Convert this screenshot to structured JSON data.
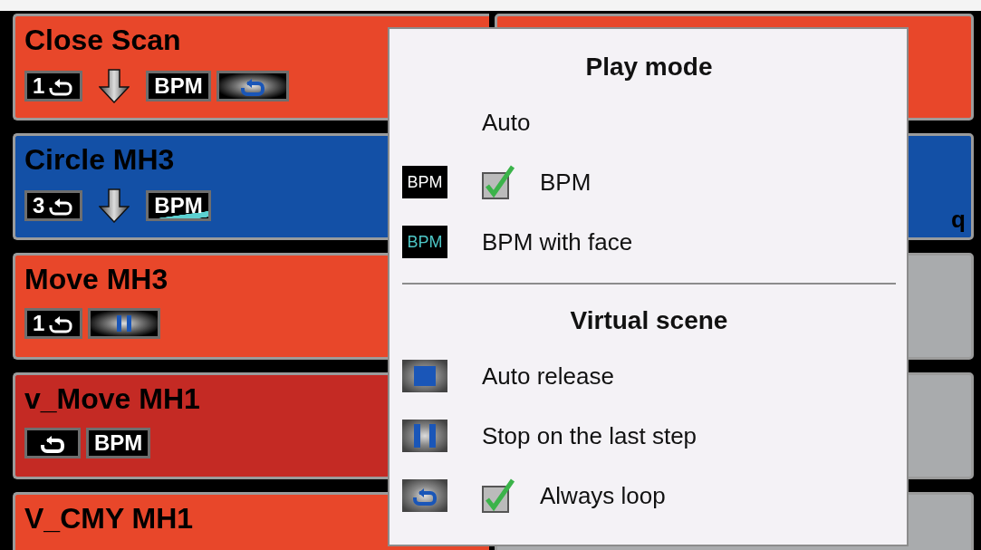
{
  "left_tiles": [
    {
      "name": "Close Scan",
      "color": "#e8472a",
      "badges": [
        {
          "kind": "count-loop",
          "text": "1"
        },
        {
          "kind": "arrow-down"
        },
        {
          "kind": "bpm",
          "text": "BPM"
        },
        {
          "kind": "loop-glow"
        }
      ]
    },
    {
      "name": "Circle MH3",
      "color": "#1350a6",
      "badges": [
        {
          "kind": "count-loop",
          "text": "3"
        },
        {
          "kind": "arrow-down"
        },
        {
          "kind": "bpm-fade",
          "text": "BPM"
        }
      ]
    },
    {
      "name": "Move MH3",
      "color": "#e8472a",
      "badges": [
        {
          "kind": "count-loop",
          "text": "1"
        },
        {
          "kind": "pause-glow"
        }
      ]
    },
    {
      "name": "v_Move MH1",
      "color": "#c42a24",
      "badges": [
        {
          "kind": "loop"
        },
        {
          "kind": "bpm",
          "text": "BPM"
        }
      ]
    },
    {
      "name": "V_CMY MH1",
      "color": "#e8472a"
    }
  ],
  "right_tiles": [
    {
      "color": "#e8472a"
    },
    {
      "color": "#1350a6",
      "text": "q"
    },
    {
      "color": "#a9abad"
    },
    {
      "color": "#a9abad"
    },
    {
      "color": "#a9abad"
    }
  ],
  "popup": {
    "sections": [
      {
        "title": "Play mode",
        "items": [
          {
            "label": "Auto",
            "checked": false
          },
          {
            "kind": "bpm",
            "icon_text": "BPM",
            "label": "BPM",
            "checked": true
          },
          {
            "kind": "bpm-fade",
            "icon_text": "BPM",
            "label": "BPM with face",
            "checked": false
          }
        ]
      },
      {
        "title": "Virtual scene",
        "items": [
          {
            "kind": "release",
            "label": "Auto release",
            "checked": false
          },
          {
            "kind": "pause",
            "label": "Stop on the last step",
            "checked": false
          },
          {
            "kind": "loop",
            "label": "Always loop",
            "checked": true
          }
        ]
      }
    ]
  }
}
